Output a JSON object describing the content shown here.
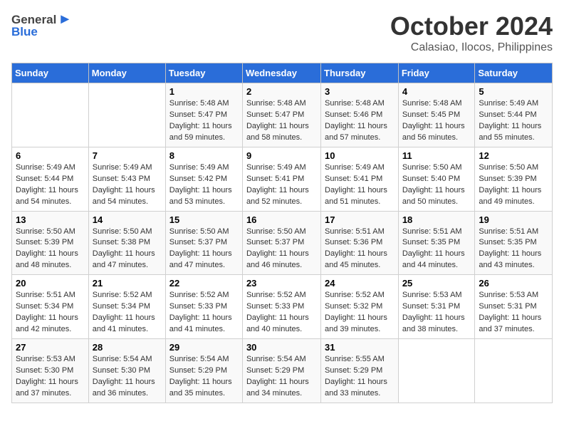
{
  "logo": {
    "general": "General",
    "blue": "Blue"
  },
  "title": "October 2024",
  "subtitle": "Calasiao, Ilocos, Philippines",
  "days_of_week": [
    "Sunday",
    "Monday",
    "Tuesday",
    "Wednesday",
    "Thursday",
    "Friday",
    "Saturday"
  ],
  "weeks": [
    [
      {
        "day": "",
        "sunrise": "",
        "sunset": "",
        "daylight": ""
      },
      {
        "day": "",
        "sunrise": "",
        "sunset": "",
        "daylight": ""
      },
      {
        "day": "1",
        "sunrise": "Sunrise: 5:48 AM",
        "sunset": "Sunset: 5:47 PM",
        "daylight": "Daylight: 11 hours and 59 minutes."
      },
      {
        "day": "2",
        "sunrise": "Sunrise: 5:48 AM",
        "sunset": "Sunset: 5:47 PM",
        "daylight": "Daylight: 11 hours and 58 minutes."
      },
      {
        "day": "3",
        "sunrise": "Sunrise: 5:48 AM",
        "sunset": "Sunset: 5:46 PM",
        "daylight": "Daylight: 11 hours and 57 minutes."
      },
      {
        "day": "4",
        "sunrise": "Sunrise: 5:48 AM",
        "sunset": "Sunset: 5:45 PM",
        "daylight": "Daylight: 11 hours and 56 minutes."
      },
      {
        "day": "5",
        "sunrise": "Sunrise: 5:49 AM",
        "sunset": "Sunset: 5:44 PM",
        "daylight": "Daylight: 11 hours and 55 minutes."
      }
    ],
    [
      {
        "day": "6",
        "sunrise": "Sunrise: 5:49 AM",
        "sunset": "Sunset: 5:44 PM",
        "daylight": "Daylight: 11 hours and 54 minutes."
      },
      {
        "day": "7",
        "sunrise": "Sunrise: 5:49 AM",
        "sunset": "Sunset: 5:43 PM",
        "daylight": "Daylight: 11 hours and 54 minutes."
      },
      {
        "day": "8",
        "sunrise": "Sunrise: 5:49 AM",
        "sunset": "Sunset: 5:42 PM",
        "daylight": "Daylight: 11 hours and 53 minutes."
      },
      {
        "day": "9",
        "sunrise": "Sunrise: 5:49 AM",
        "sunset": "Sunset: 5:41 PM",
        "daylight": "Daylight: 11 hours and 52 minutes."
      },
      {
        "day": "10",
        "sunrise": "Sunrise: 5:49 AM",
        "sunset": "Sunset: 5:41 PM",
        "daylight": "Daylight: 11 hours and 51 minutes."
      },
      {
        "day": "11",
        "sunrise": "Sunrise: 5:50 AM",
        "sunset": "Sunset: 5:40 PM",
        "daylight": "Daylight: 11 hours and 50 minutes."
      },
      {
        "day": "12",
        "sunrise": "Sunrise: 5:50 AM",
        "sunset": "Sunset: 5:39 PM",
        "daylight": "Daylight: 11 hours and 49 minutes."
      }
    ],
    [
      {
        "day": "13",
        "sunrise": "Sunrise: 5:50 AM",
        "sunset": "Sunset: 5:39 PM",
        "daylight": "Daylight: 11 hours and 48 minutes."
      },
      {
        "day": "14",
        "sunrise": "Sunrise: 5:50 AM",
        "sunset": "Sunset: 5:38 PM",
        "daylight": "Daylight: 11 hours and 47 minutes."
      },
      {
        "day": "15",
        "sunrise": "Sunrise: 5:50 AM",
        "sunset": "Sunset: 5:37 PM",
        "daylight": "Daylight: 11 hours and 47 minutes."
      },
      {
        "day": "16",
        "sunrise": "Sunrise: 5:50 AM",
        "sunset": "Sunset: 5:37 PM",
        "daylight": "Daylight: 11 hours and 46 minutes."
      },
      {
        "day": "17",
        "sunrise": "Sunrise: 5:51 AM",
        "sunset": "Sunset: 5:36 PM",
        "daylight": "Daylight: 11 hours and 45 minutes."
      },
      {
        "day": "18",
        "sunrise": "Sunrise: 5:51 AM",
        "sunset": "Sunset: 5:35 PM",
        "daylight": "Daylight: 11 hours and 44 minutes."
      },
      {
        "day": "19",
        "sunrise": "Sunrise: 5:51 AM",
        "sunset": "Sunset: 5:35 PM",
        "daylight": "Daylight: 11 hours and 43 minutes."
      }
    ],
    [
      {
        "day": "20",
        "sunrise": "Sunrise: 5:51 AM",
        "sunset": "Sunset: 5:34 PM",
        "daylight": "Daylight: 11 hours and 42 minutes."
      },
      {
        "day": "21",
        "sunrise": "Sunrise: 5:52 AM",
        "sunset": "Sunset: 5:34 PM",
        "daylight": "Daylight: 11 hours and 41 minutes."
      },
      {
        "day": "22",
        "sunrise": "Sunrise: 5:52 AM",
        "sunset": "Sunset: 5:33 PM",
        "daylight": "Daylight: 11 hours and 41 minutes."
      },
      {
        "day": "23",
        "sunrise": "Sunrise: 5:52 AM",
        "sunset": "Sunset: 5:33 PM",
        "daylight": "Daylight: 11 hours and 40 minutes."
      },
      {
        "day": "24",
        "sunrise": "Sunrise: 5:52 AM",
        "sunset": "Sunset: 5:32 PM",
        "daylight": "Daylight: 11 hours and 39 minutes."
      },
      {
        "day": "25",
        "sunrise": "Sunrise: 5:53 AM",
        "sunset": "Sunset: 5:31 PM",
        "daylight": "Daylight: 11 hours and 38 minutes."
      },
      {
        "day": "26",
        "sunrise": "Sunrise: 5:53 AM",
        "sunset": "Sunset: 5:31 PM",
        "daylight": "Daylight: 11 hours and 37 minutes."
      }
    ],
    [
      {
        "day": "27",
        "sunrise": "Sunrise: 5:53 AM",
        "sunset": "Sunset: 5:30 PM",
        "daylight": "Daylight: 11 hours and 37 minutes."
      },
      {
        "day": "28",
        "sunrise": "Sunrise: 5:54 AM",
        "sunset": "Sunset: 5:30 PM",
        "daylight": "Daylight: 11 hours and 36 minutes."
      },
      {
        "day": "29",
        "sunrise": "Sunrise: 5:54 AM",
        "sunset": "Sunset: 5:29 PM",
        "daylight": "Daylight: 11 hours and 35 minutes."
      },
      {
        "day": "30",
        "sunrise": "Sunrise: 5:54 AM",
        "sunset": "Sunset: 5:29 PM",
        "daylight": "Daylight: 11 hours and 34 minutes."
      },
      {
        "day": "31",
        "sunrise": "Sunrise: 5:55 AM",
        "sunset": "Sunset: 5:29 PM",
        "daylight": "Daylight: 11 hours and 33 minutes."
      },
      {
        "day": "",
        "sunrise": "",
        "sunset": "",
        "daylight": ""
      },
      {
        "day": "",
        "sunrise": "",
        "sunset": "",
        "daylight": ""
      }
    ]
  ]
}
